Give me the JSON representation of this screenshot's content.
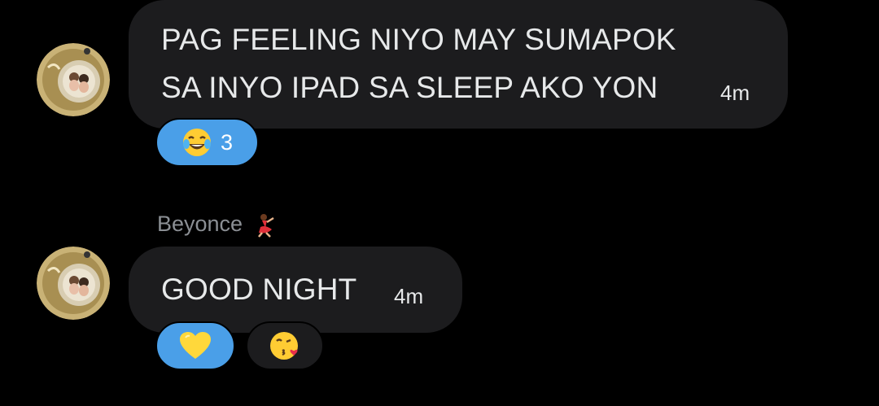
{
  "messages": [
    {
      "lines": [
        "PAG FEELING NIYO MAY SUMAPOK",
        "SA INYO IPAD SA SLEEP AKO YON"
      ],
      "time": "4m",
      "reactions": [
        {
          "emoji": "face-with-tears-of-joy",
          "count": "3",
          "selected": true
        }
      ]
    },
    {
      "sender": "Beyonce",
      "sender_emoji": "dancer",
      "text": "GOOD NIGHT",
      "time": "4m",
      "reactions": [
        {
          "emoji": "yellow-heart",
          "selected": true
        },
        {
          "emoji": "face-blowing-a-kiss",
          "selected": false
        }
      ]
    }
  ],
  "colors": {
    "background": "#000000",
    "bubble": "#1c1c1e",
    "selected_reaction": "#4a9fe8",
    "sender_name": "#8b8f94",
    "text": "#e7e9ea"
  }
}
